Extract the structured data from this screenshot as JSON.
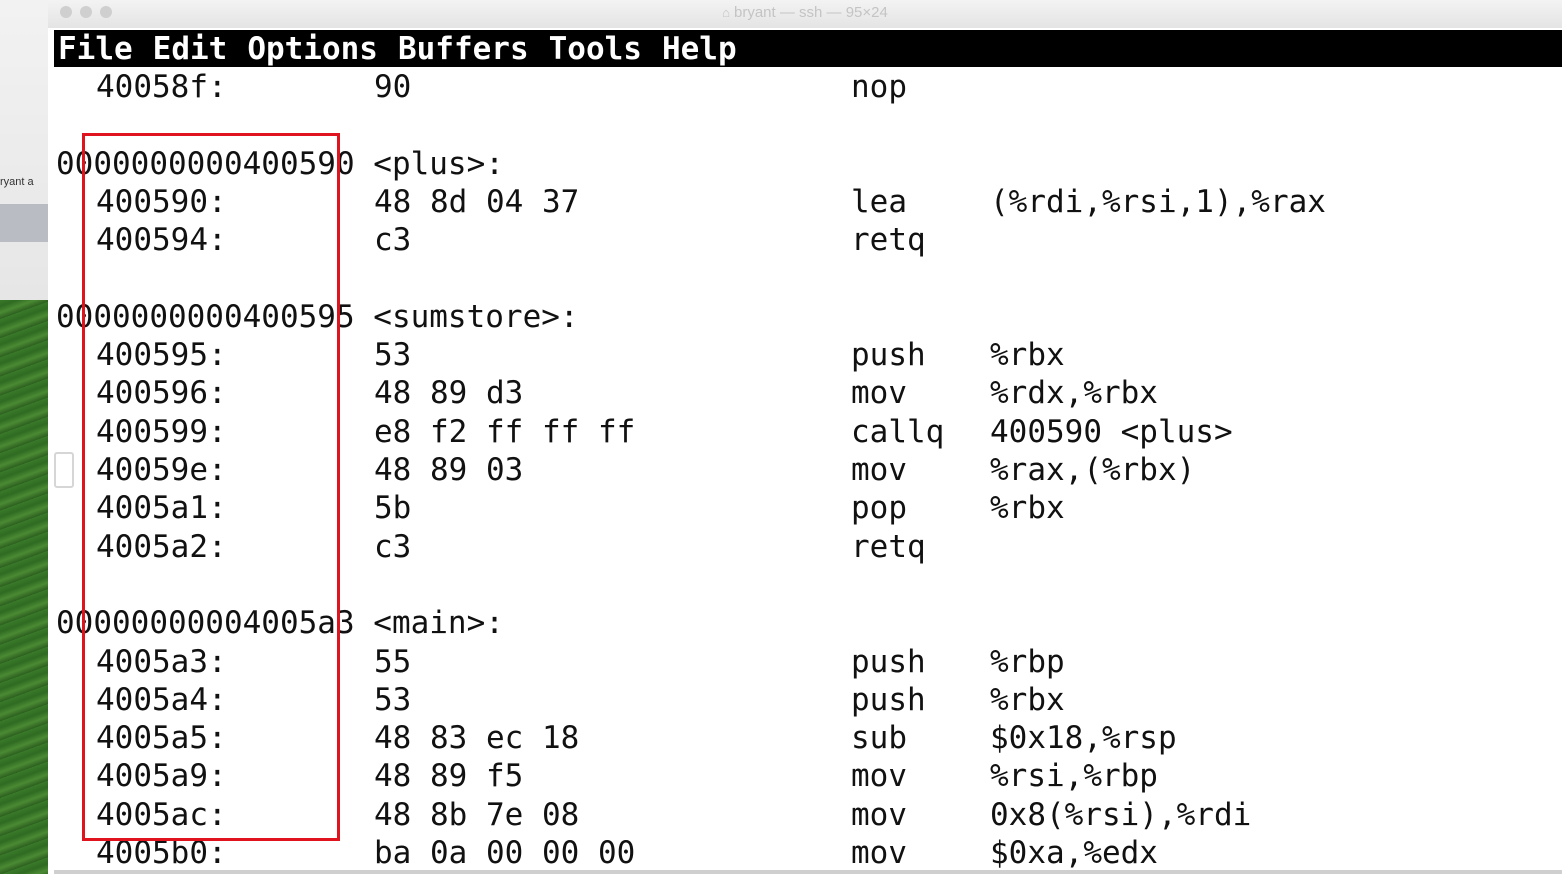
{
  "desktop": {
    "side_label": "ryant a"
  },
  "window": {
    "title": "bryant — ssh — 95×24",
    "title_icon": "home-icon"
  },
  "menubar": {
    "items": [
      {
        "label": "File"
      },
      {
        "label": "Edit"
      },
      {
        "label": "Options"
      },
      {
        "label": "Buffers"
      },
      {
        "label": "Tools"
      },
      {
        "label": "Help"
      }
    ]
  },
  "disassembly": {
    "lines": [
      {
        "kind": "insn",
        "addr": "40058f:",
        "bytes": "90",
        "mnemonic": "nop",
        "operands": ""
      },
      {
        "kind": "blank"
      },
      {
        "kind": "header",
        "text": "0000000000400590 <plus>:"
      },
      {
        "kind": "insn",
        "addr": "400590:",
        "bytes": "48 8d 04 37",
        "mnemonic": "lea",
        "operands": "(%rdi,%rsi,1),%rax"
      },
      {
        "kind": "insn",
        "addr": "400594:",
        "bytes": "c3",
        "mnemonic": "retq",
        "operands": ""
      },
      {
        "kind": "blank"
      },
      {
        "kind": "header",
        "text": "0000000000400595 <sumstore>:"
      },
      {
        "kind": "insn",
        "addr": "400595:",
        "bytes": "53",
        "mnemonic": "push",
        "operands": "%rbx"
      },
      {
        "kind": "insn",
        "addr": "400596:",
        "bytes": "48 89 d3",
        "mnemonic": "mov",
        "operands": "%rdx,%rbx"
      },
      {
        "kind": "insn",
        "addr": "400599:",
        "bytes": "e8 f2 ff ff ff",
        "mnemonic": "callq",
        "operands": "400590 <plus>"
      },
      {
        "kind": "insn",
        "addr": "40059e:",
        "bytes": "48 89 03",
        "mnemonic": "mov",
        "operands": "%rax,(%rbx)"
      },
      {
        "kind": "insn",
        "addr": "4005a1:",
        "bytes": "5b",
        "mnemonic": "pop",
        "operands": "%rbx"
      },
      {
        "kind": "insn",
        "addr": "4005a2:",
        "bytes": "c3",
        "mnemonic": "retq",
        "operands": ""
      },
      {
        "kind": "blank"
      },
      {
        "kind": "header",
        "text": "00000000004005a3 <main>:"
      },
      {
        "kind": "insn",
        "addr": "4005a3:",
        "bytes": "55",
        "mnemonic": "push",
        "operands": "%rbp"
      },
      {
        "kind": "insn",
        "addr": "4005a4:",
        "bytes": "53",
        "mnemonic": "push",
        "operands": "%rbx"
      },
      {
        "kind": "insn",
        "addr": "4005a5:",
        "bytes": "48 83 ec 18",
        "mnemonic": "sub",
        "operands": "$0x18,%rsp"
      },
      {
        "kind": "insn",
        "addr": "4005a9:",
        "bytes": "48 89 f5",
        "mnemonic": "mov",
        "operands": "%rsi,%rbp"
      },
      {
        "kind": "insn",
        "addr": "4005ac:",
        "bytes": "48 8b 7e 08",
        "mnemonic": "mov",
        "operands": "0x8(%rsi),%rdi"
      },
      {
        "kind": "insn",
        "addr": "4005b0:",
        "bytes": "ba 0a 00 00 00",
        "mnemonic": "mov",
        "operands": "$0xa,%edx"
      }
    ]
  },
  "annotation": {
    "highlight_color": "#e0141e"
  }
}
